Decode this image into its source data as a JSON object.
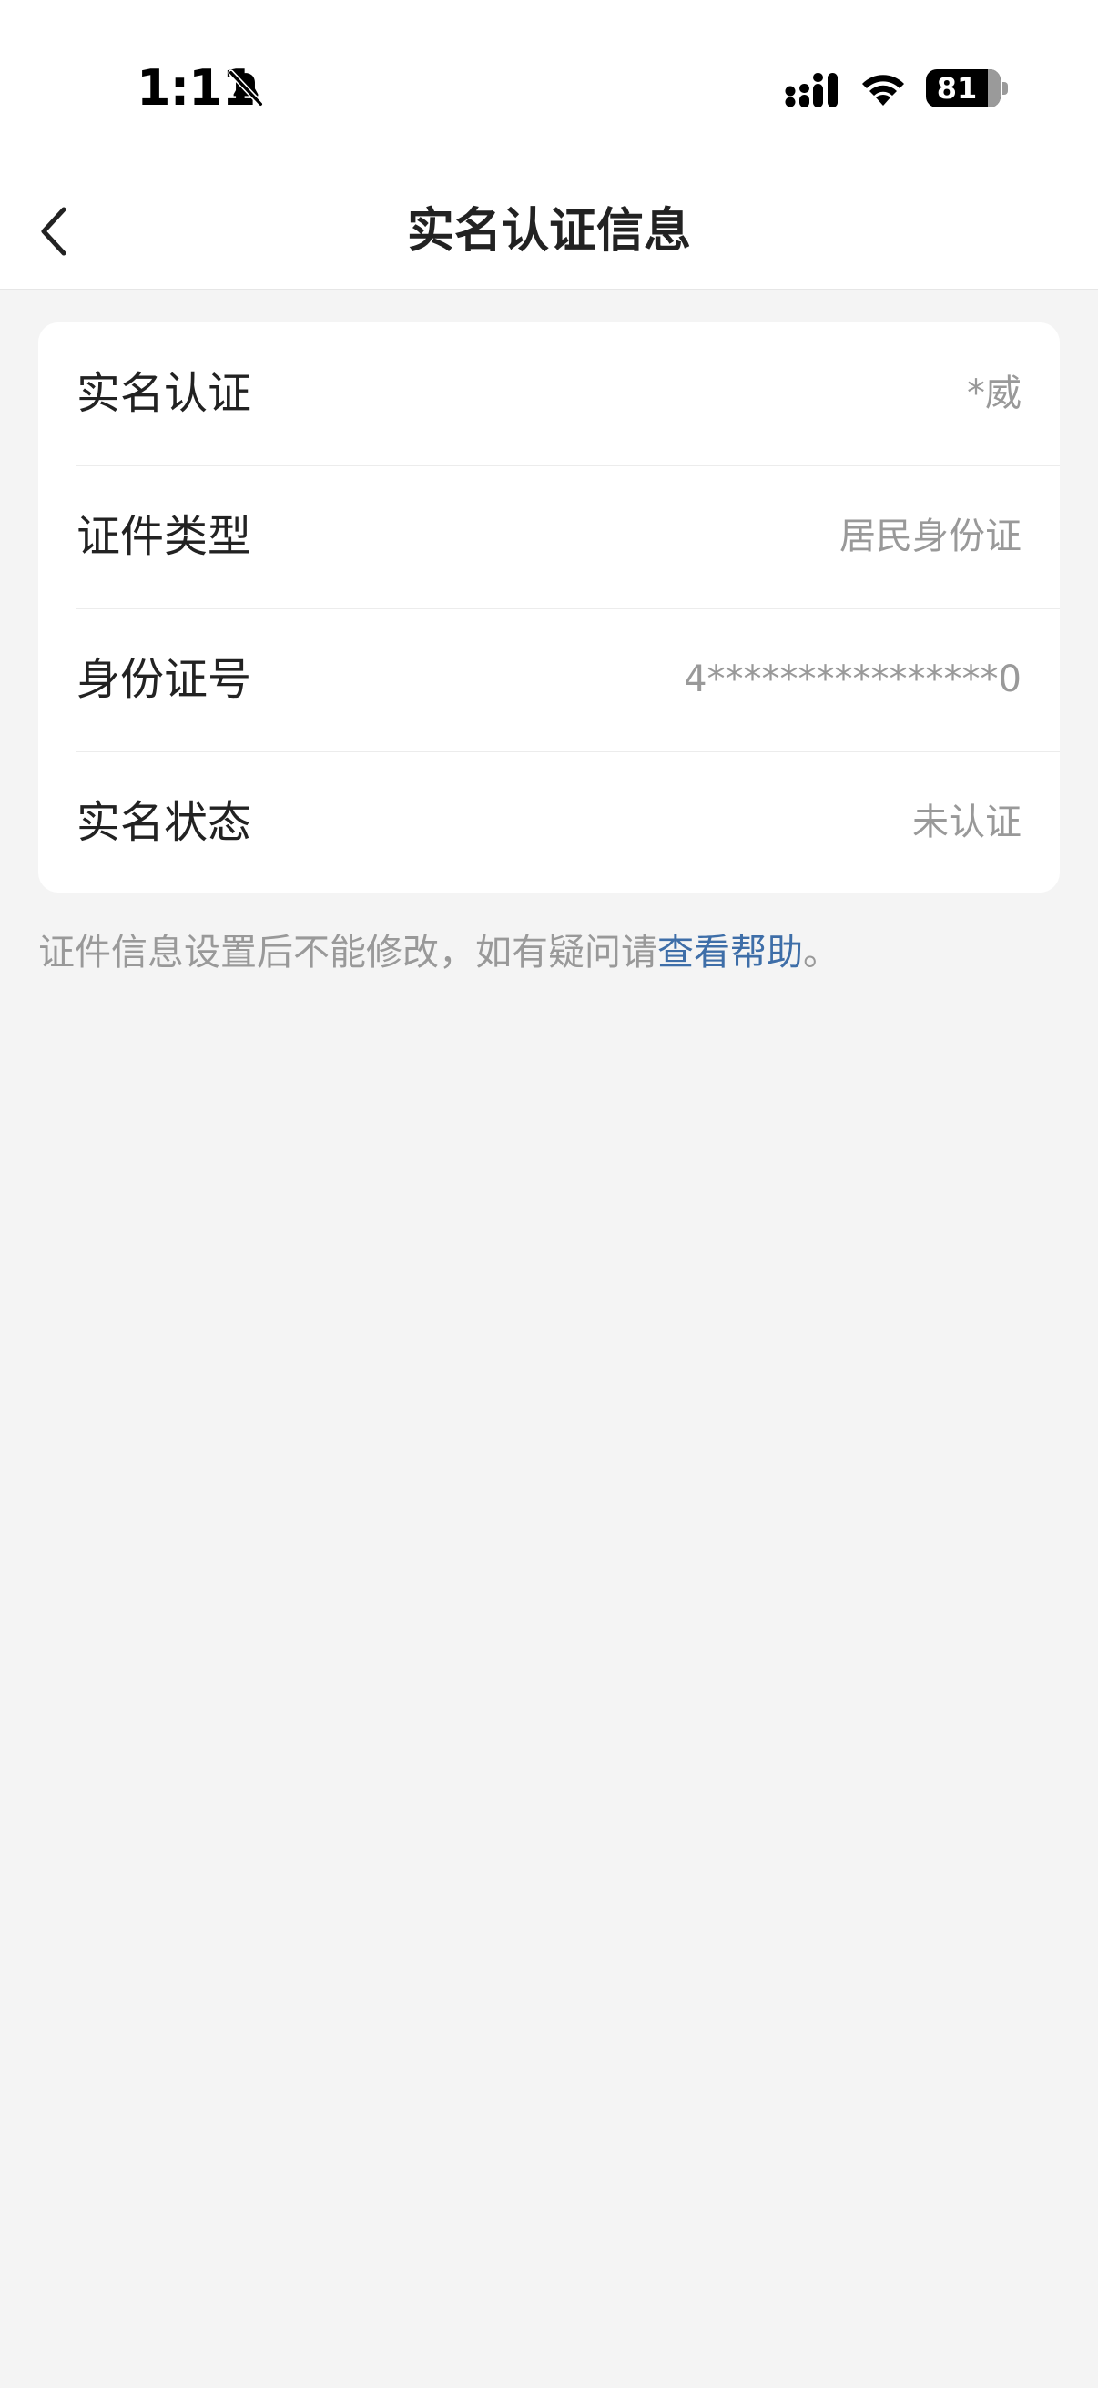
{
  "status_bar": {
    "time": "1:11",
    "battery": "81"
  },
  "nav": {
    "title": "实名认证信息"
  },
  "rows": [
    {
      "label": "实名认证",
      "value": "*威"
    },
    {
      "label": "证件类型",
      "value": "居民身份证"
    },
    {
      "label": "身份证号",
      "value": "4****************0"
    },
    {
      "label": "实名状态",
      "value": "未认证"
    }
  ],
  "notice": {
    "text": "证件信息设置后不能修改，如有疑问请",
    "link": "查看帮助",
    "suffix": "。"
  },
  "colors": {
    "background": "#f4f4f4",
    "card": "#ffffff",
    "link": "#3e6ea8",
    "muted": "#999999"
  }
}
